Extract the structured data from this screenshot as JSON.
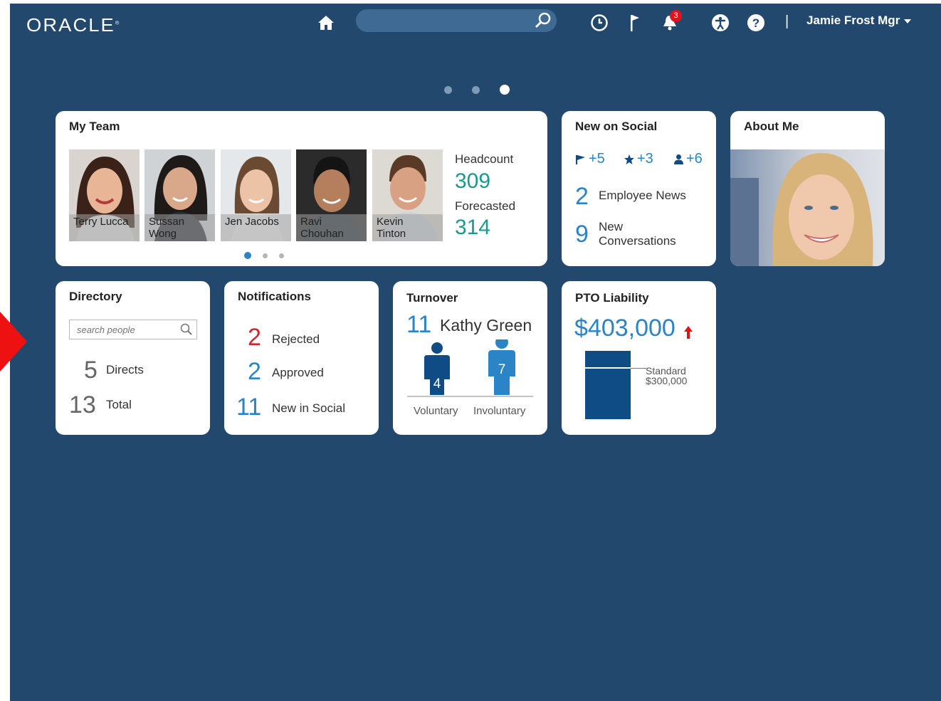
{
  "header": {
    "logo": "ORACLE",
    "search": {
      "placeholder": "",
      "value": ""
    },
    "notification_count": "3",
    "user_name": "Jamie Frost Mgr",
    "icons": [
      "home-icon",
      "search-icon",
      "clock-icon",
      "flag-icon",
      "bell-icon",
      "accessibility-icon",
      "help-icon"
    ]
  },
  "page_indicator": {
    "count": 3,
    "active_index": 2
  },
  "my_team": {
    "title": "My Team",
    "members": [
      {
        "first": "Terry Lucca",
        "last": ""
      },
      {
        "first": "Sussan",
        "last": "Wong"
      },
      {
        "first": "Jen Jacobs",
        "last": ""
      },
      {
        "first": "Ravi",
        "last": "Chouhan"
      },
      {
        "first": "Kevin",
        "last": "Tinton"
      }
    ],
    "headcount_label": "Headcount",
    "headcount_value": "309",
    "forecasted_label": "Forecasted",
    "forecasted_value": "314",
    "carousel": {
      "count": 3,
      "active_index": 0
    }
  },
  "new_on_social": {
    "title": "New on Social",
    "chips": [
      {
        "icon": "flag-icon",
        "text": "+5"
      },
      {
        "icon": "star-icon",
        "text": "+3"
      },
      {
        "icon": "person-icon",
        "text": "+6"
      }
    ],
    "rows": [
      {
        "value": "2",
        "label": "Employee News"
      },
      {
        "value": "9",
        "label": "New Conversations"
      }
    ]
  },
  "about_me": {
    "title": "About Me"
  },
  "directory": {
    "title": "Directory",
    "search_placeholder": "search people",
    "rows": [
      {
        "value": "5",
        "label": "Directs"
      },
      {
        "value": "13",
        "label": "Total"
      }
    ]
  },
  "notifications": {
    "title": "Notifications",
    "rows": [
      {
        "value": "2",
        "label": "Rejected"
      },
      {
        "value": "2",
        "label": "Approved"
      },
      {
        "value": "11",
        "label": "New in Social"
      }
    ]
  },
  "turnover": {
    "title": "Turnover",
    "count": "11",
    "name": "Kathy Green",
    "voluntary_label": "Voluntary",
    "voluntary_value": "4",
    "involuntary_label": "Involuntary",
    "involuntary_value": "7"
  },
  "pto_liability": {
    "title": "PTO Liability",
    "amount": "$403,000",
    "standard_label": "Standard",
    "standard_value": "$300,000",
    "amount_numeric": 403000,
    "standard_numeric": 300000
  },
  "colors": {
    "background": "#22486e",
    "accent": "#2a84c6",
    "teal": "#1a9a8e",
    "alert_red": "#e0131b",
    "navy": "#0f4b85"
  }
}
